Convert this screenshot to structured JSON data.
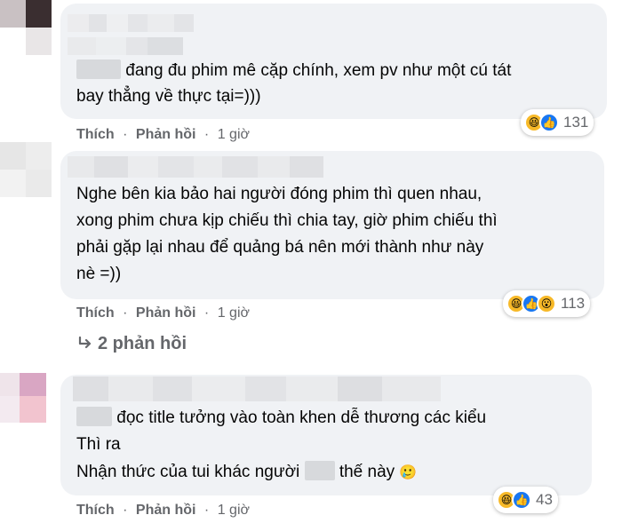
{
  "comments": [
    {
      "lines": [
        "đang đu phim mê cặp chính, xem pv như một cú tát",
        "bay thẳng về thực tại=)))"
      ],
      "reactions": {
        "icons": [
          "haha-icon",
          "like-icon"
        ],
        "count": "131"
      },
      "actions": {
        "like": "Thích",
        "reply": "Phản hồi",
        "separator": "·",
        "time": "1 giờ"
      }
    },
    {
      "lines": [
        "Nghe bên kia bảo hai người đóng phim thì quen nhau,",
        "xong phim chưa kịp chiếu thì chia tay, giờ phim chiếu thì",
        "phải gặp lại nhau để quảng bá nên mới thành như này",
        "nè =))"
      ],
      "reactions": {
        "icons": [
          "haha-icon",
          "like-icon",
          "wow-icon"
        ],
        "count": "113"
      },
      "actions": {
        "like": "Thích",
        "reply": "Phản hồi",
        "separator": "·",
        "time": "1 giờ"
      },
      "replies_link": "2 phản hồi"
    },
    {
      "line1": "đọc title tưởng vào toàn khen dễ thương các kiểu",
      "line2": "Thì ra",
      "line3_before": "Nhận thức của tui khác người",
      "line3_after": "thế này",
      "line3_emoji": "🥲",
      "reactions": {
        "icons": [
          "haha-icon",
          "like-icon"
        ],
        "count": "43"
      },
      "actions": {
        "like": "Thích",
        "reply": "Phản hồi",
        "separator": "·",
        "time": "1 giờ"
      }
    }
  ],
  "colors": {
    "bubble": "#f0f2f5",
    "text": "#050505",
    "secondary": "#65676b",
    "like": "#1877f2",
    "haha": "#f7b928"
  }
}
